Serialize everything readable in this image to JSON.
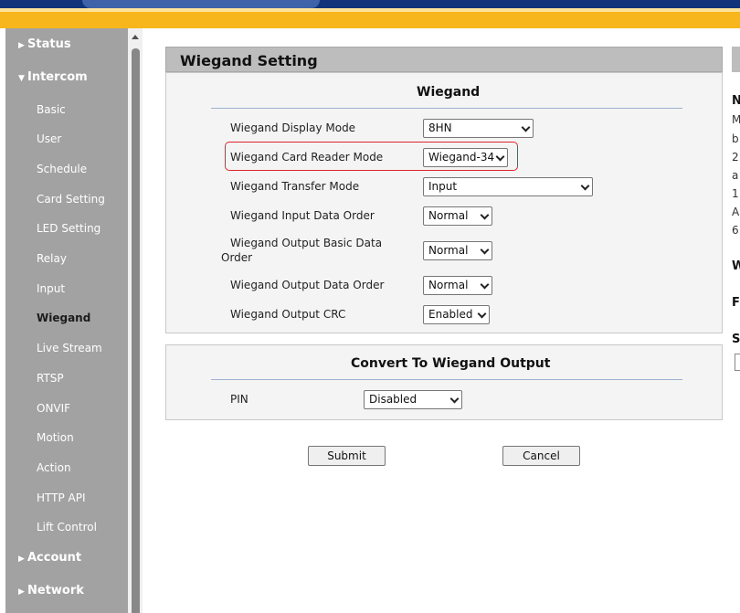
{
  "sidebar": {
    "status": "Status",
    "intercom": "Intercom",
    "items": [
      "Basic",
      "User",
      "Schedule",
      "Card Setting",
      "LED Setting",
      "Relay",
      "Input",
      "Wiegand",
      "Live Stream",
      "RTSP",
      "ONVIF",
      "Motion",
      "Action",
      "HTTP API",
      "Lift Control"
    ],
    "active": "Wiegand",
    "account": "Account",
    "network": "Network"
  },
  "page": {
    "title": "Wiegand Setting"
  },
  "wiegand": {
    "title": "Wiegand",
    "display_mode": {
      "label": "Wiegand Display Mode",
      "value": "8HN"
    },
    "card_reader_mode": {
      "label": "Wiegand Card Reader Mode",
      "value": "Wiegand-34"
    },
    "transfer_mode": {
      "label": "Wiegand Transfer Mode",
      "value": "Input"
    },
    "input_order": {
      "label": "Wiegand Input Data Order",
      "value": "Normal"
    },
    "output_basic_order": {
      "label_line1": "Wiegand Output Basic Data",
      "label_line2": "Order",
      "value": "Normal"
    },
    "output_order": {
      "label": "Wiegand Output Data Order",
      "value": "Normal"
    },
    "output_crc": {
      "label": "Wiegand Output CRC",
      "value": "Enabled"
    }
  },
  "convert": {
    "title": "Convert To Wiegand Output",
    "pin": {
      "label": "PIN",
      "value": "Disabled"
    }
  },
  "buttons": {
    "submit": "Submit",
    "cancel": "Cancel"
  },
  "right_clipped": {
    "heading1": "N",
    "lines": [
      "M",
      "b",
      "2",
      "a",
      "1",
      "A",
      "6"
    ],
    "heading2": "W",
    "heading3": "F",
    "heading4": "S"
  },
  "colors": {
    "topbar": "#f7b71c",
    "sidebar": "#a2a2a2",
    "highlight": "#e0262e"
  }
}
